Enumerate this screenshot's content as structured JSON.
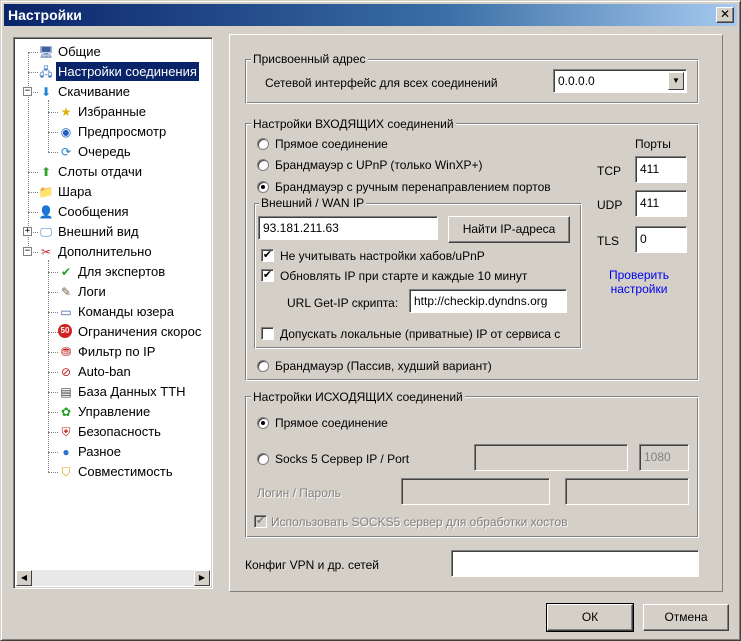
{
  "window": {
    "title": "Настройки",
    "close_glyph": "✕"
  },
  "tree": {
    "items": [
      {
        "label": "Общие",
        "icon": "general-icon",
        "glyph": "🖥",
        "color": "#4060a0"
      },
      {
        "label": "Настройки соединения",
        "icon": "connection-icon",
        "glyph": "🖧",
        "color": "#3070c0"
      },
      {
        "label": "Скачивание",
        "icon": "download-icon",
        "glyph": "⬇",
        "color": "#2080d0",
        "expander": "−"
      },
      {
        "label": "Избранные",
        "icon": "favorites-star-icon",
        "glyph": "★",
        "color": "#e0b000"
      },
      {
        "label": "Предпросмотр",
        "icon": "preview-icon",
        "glyph": "◉",
        "color": "#2060c0"
      },
      {
        "label": "Очередь",
        "icon": "queue-icon",
        "glyph": "⟳",
        "color": "#2080d0"
      },
      {
        "label": "Слоты отдачи",
        "icon": "upload-slots-icon",
        "glyph": "⬆",
        "color": "#30a030"
      },
      {
        "label": "Шара",
        "icon": "share-icon",
        "glyph": "📁",
        "color": "#3060b0"
      },
      {
        "label": "Сообщения",
        "icon": "messages-icon",
        "glyph": "👤",
        "color": "#806040"
      },
      {
        "label": "Внешний вид",
        "icon": "appearance-icon",
        "glyph": "🖵",
        "color": "#4080c0",
        "expander": "+"
      },
      {
        "label": "Дополнительно",
        "icon": "advanced-icon",
        "glyph": "✂",
        "color": "#c03030",
        "expander": "−"
      },
      {
        "label": "Для экспертов",
        "icon": "experts-icon",
        "glyph": "✔",
        "color": "#20a020"
      },
      {
        "label": "Логи",
        "icon": "logs-icon",
        "glyph": "✎",
        "color": "#806040"
      },
      {
        "label": "Команды юзера",
        "icon": "user-commands-icon",
        "glyph": "▭",
        "color": "#4060a0"
      },
      {
        "label": "Ограничения скорос",
        "icon": "speed-limit-icon",
        "glyph": "50",
        "color": "#d02020"
      },
      {
        "label": "Фильтр по IP",
        "icon": "ip-filter-icon",
        "glyph": "⛃",
        "color": "#c02020"
      },
      {
        "label": "Auto-ban",
        "icon": "auto-ban-icon",
        "glyph": "⊘",
        "color": "#c02020"
      },
      {
        "label": "База Данных TTH",
        "icon": "tth-database-icon",
        "glyph": "▤",
        "color": "#404040"
      },
      {
        "label": "Управление",
        "icon": "management-icon",
        "glyph": "✿",
        "color": "#20a020"
      },
      {
        "label": "Безопасность",
        "icon": "security-icon",
        "glyph": "⛨",
        "color": "#c02020"
      },
      {
        "label": "Разное",
        "icon": "misc-icon",
        "glyph": "●",
        "color": "#3070d0"
      },
      {
        "label": "Совместимость",
        "icon": "compatibility-icon",
        "glyph": "⛉",
        "color": "#e0a000"
      }
    ],
    "scroll_left": "◀",
    "scroll_right": "▶"
  },
  "assigned_address": {
    "title": "Присвоенный адрес",
    "label": "Сетевой интерфейс для всех соединений",
    "value": "0.0.0.0",
    "arrow": "▼"
  },
  "incoming": {
    "title": "Настройки ВХОДЯЩИХ соединений",
    "radio_direct": "Прямое соединение",
    "radio_upnp": "Брандмауэр с UPnP (только WinXP+)",
    "radio_manual": "Брандмауэр с ручным перенаправлением портов",
    "radio_passive": "Брандмауэр (Пассив, худший вариант)",
    "wan_title": "Внешний / WAN IP",
    "wan_ip": "93.181.211.63",
    "find_ip_button": "Найти IP-адреса",
    "check_ignore_hubs": "Не учитывать настройки хабов/uPnP",
    "check_update_ip": "Обновлять IP при старте и каждые 10 минут",
    "url_label": "URL Get-IP скрипта:",
    "url_value": "http://checkip.dyndns.org",
    "check_allow_local": "Допускать локальные (приватные) IP от сервиса с",
    "check_mark": "✔",
    "ports_title": "Порты",
    "tcp_label": "TCP",
    "tcp_value": "411",
    "udp_label": "UDP",
    "udp_value": "411",
    "tls_label": "TLS",
    "tls_value": "0",
    "check_link_1": "Проверить",
    "check_link_2": "настройки"
  },
  "outgoing": {
    "title": "Настройки ИСХОДЯЩИХ соединений",
    "radio_direct": "Прямое соединение",
    "radio_socks": "Socks 5 Сервер IP / Port",
    "socks_port": "1080",
    "login_label": "Логин / Пароль",
    "check_socks_hosts": "Использовать SOCKS5 сервер для обработки хостов",
    "check_mark": "✔"
  },
  "vpn": {
    "label": "Конфиг VPN и др. сетей",
    "value": ""
  },
  "buttons": {
    "ok": "ОК",
    "cancel": "Отмена"
  }
}
